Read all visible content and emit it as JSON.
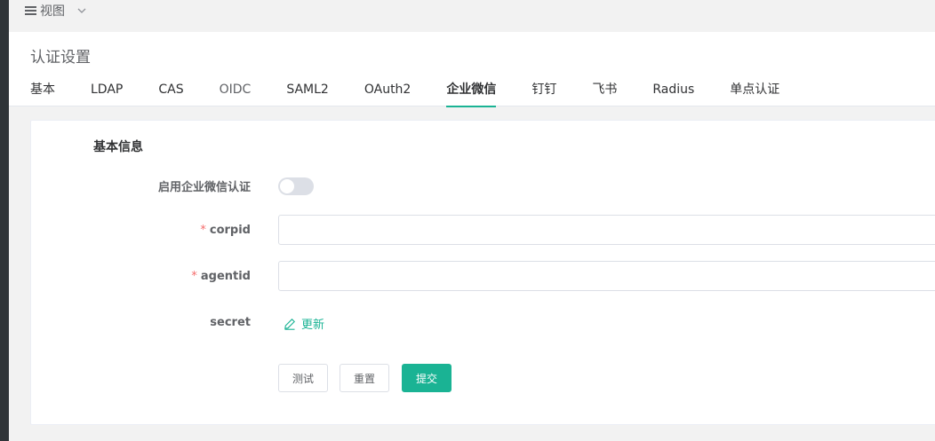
{
  "topbar": {
    "view_label": "视图"
  },
  "header": {
    "title": "认证设置",
    "tabs": [
      {
        "label": "基本",
        "state": "normal"
      },
      {
        "label": "LDAP",
        "state": "normal"
      },
      {
        "label": "CAS",
        "state": "normal"
      },
      {
        "label": "OIDC",
        "state": "muted"
      },
      {
        "label": "SAML2",
        "state": "normal"
      },
      {
        "label": "OAuth2",
        "state": "normal"
      },
      {
        "label": "企业微信",
        "state": "active"
      },
      {
        "label": "钉钉",
        "state": "normal"
      },
      {
        "label": "飞书",
        "state": "normal"
      },
      {
        "label": "Radius",
        "state": "normal"
      },
      {
        "label": "单点认证",
        "state": "normal"
      }
    ]
  },
  "form": {
    "section_title": "基本信息",
    "enable": {
      "label": "启用企业微信认证",
      "checked": false
    },
    "corpid": {
      "required_mark": "*",
      "label": "corpid",
      "value": ""
    },
    "agentid": {
      "required_mark": "*",
      "label": "agentid",
      "value": ""
    },
    "secret": {
      "label": "secret",
      "update_label": "更新"
    },
    "buttons": {
      "test": "测试",
      "reset": "重置",
      "submit": "提交"
    }
  },
  "colors": {
    "accent": "#1ab394",
    "required": "#f56c6c",
    "border": "#dcdfe6"
  },
  "icons": [
    "menu-icon",
    "chevron-down-icon",
    "edit-icon"
  ]
}
